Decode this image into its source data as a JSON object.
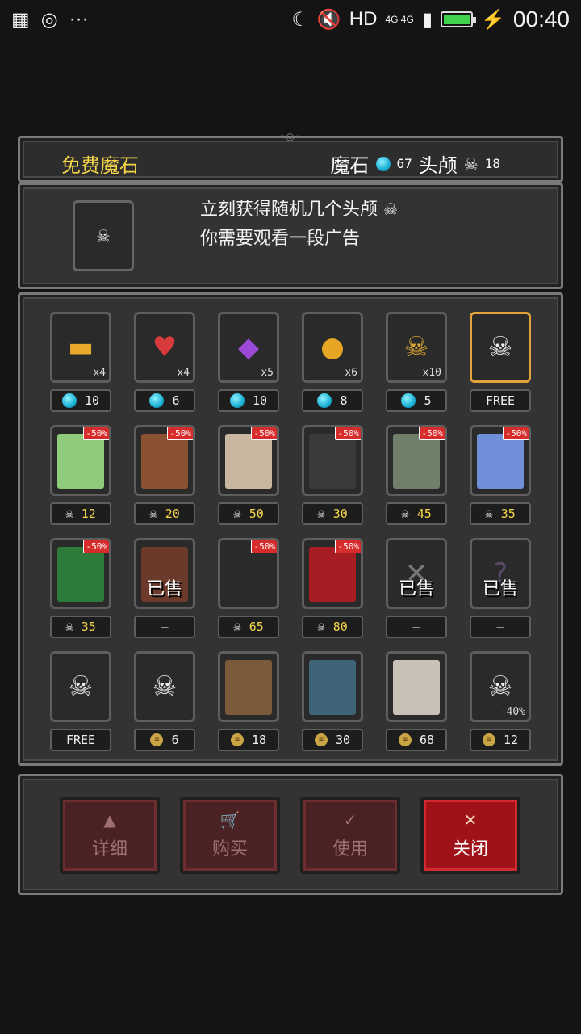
{
  "statusbar": {
    "hd": "HD",
    "network": "4G 4G",
    "time": "00:40"
  },
  "header": {
    "title": "免费魔石",
    "gem_label": "魔石",
    "gem_count": "67",
    "skull_label": "头颅",
    "skull_count": "18"
  },
  "info": {
    "line1": "立刻获得随机几个头颅",
    "line2": "你需要观看一段广告"
  },
  "items": [
    {
      "icon": "gold-bars-icon",
      "glyph": "▬",
      "color": "#e9a92a",
      "qty": "x4",
      "price": "10",
      "currency": "gem"
    },
    {
      "icon": "heart-scroll-icon",
      "glyph": "♥",
      "color": "#d73a3a",
      "qty": "x4",
      "price": "6",
      "currency": "gem"
    },
    {
      "icon": "purple-crystal-icon",
      "glyph": "◆",
      "color": "#9a4ad6",
      "qty": "x5",
      "price": "10",
      "currency": "gem"
    },
    {
      "icon": "golden-apple-icon",
      "glyph": "●",
      "color": "#e6a523",
      "qty": "x6",
      "price": "8",
      "currency": "gem"
    },
    {
      "icon": "skull-amulet-icon",
      "glyph": "☠",
      "color": "#d8a533",
      "qty": "x10",
      "price": "5",
      "currency": "gem"
    },
    {
      "icon": "skull-icon",
      "glyph": "☠",
      "color": "#eeeeee",
      "qty": "",
      "price": "FREE",
      "currency": "none",
      "selected": true
    },
    {
      "icon": "slime-icon",
      "glyph": "",
      "art": "#8ecb7a",
      "discount": "-50%",
      "price": "12",
      "currency": "skull"
    },
    {
      "icon": "treant-icon",
      "glyph": "",
      "art": "#8a5230",
      "discount": "-50%",
      "price": "20",
      "currency": "skull"
    },
    {
      "icon": "skeleton-warrior-icon",
      "glyph": "",
      "art": "#c9b7a0",
      "discount": "-50%",
      "price": "50",
      "currency": "skull"
    },
    {
      "icon": "dark-reaper-icon",
      "glyph": "",
      "art": "#3a3a3a",
      "discount": "-50%",
      "price": "30",
      "currency": "skull"
    },
    {
      "icon": "zombie-knight-icon",
      "glyph": "",
      "art": "#6f7f6a",
      "discount": "-50%",
      "price": "45",
      "currency": "skull"
    },
    {
      "icon": "priestess-icon",
      "glyph": "",
      "art": "#6f90d8",
      "discount": "-50%",
      "price": "35",
      "currency": "skull"
    },
    {
      "icon": "forest-guardian-icon",
      "glyph": "",
      "art": "#2e7a3a",
      "discount": "-50%",
      "price": "35",
      "currency": "skull"
    },
    {
      "icon": "girl-character-icon",
      "glyph": "",
      "art": "#6b3a2a",
      "sold": "已售",
      "price": "—",
      "currency": "none"
    },
    {
      "icon": "shadow-demon-icon",
      "glyph": "",
      "art": "#2b2b2b",
      "discount": "-50%",
      "price": "65",
      "currency": "skull"
    },
    {
      "icon": "witch-icon",
      "glyph": "",
      "art": "#a81c24",
      "discount": "-50%",
      "price": "80",
      "currency": "skull"
    },
    {
      "icon": "crossed-swords-icon",
      "glyph": "✕",
      "color": "#777777",
      "sold": "已售",
      "price": "—",
      "currency": "none"
    },
    {
      "icon": "mystery-door-icon",
      "glyph": "?",
      "color": "#5a4a6a",
      "sold": "已售",
      "price": "—",
      "currency": "none"
    },
    {
      "icon": "skull-to-gem-icon",
      "glyph": "☠",
      "color": "#eeeeee",
      "price": "FREE",
      "currency": "none"
    },
    {
      "icon": "skull-pile-icon",
      "glyph": "☠",
      "color": "#eeeeee",
      "price": "6",
      "currency": "coin"
    },
    {
      "icon": "brown-chest-icon",
      "glyph": "",
      "art": "#7a5a3a",
      "price": "18",
      "currency": "coin"
    },
    {
      "icon": "blue-chest-icon",
      "glyph": "",
      "art": "#3f6377",
      "price": "30",
      "currency": "coin"
    },
    {
      "icon": "golden-chest-icon",
      "glyph": "",
      "art": "#c9c0b6",
      "price": "68",
      "currency": "coin"
    },
    {
      "icon": "skull-scroll-icon",
      "glyph": "☠",
      "color": "#eeeeee",
      "qty": "-40%",
      "price": "12",
      "currency": "coin"
    }
  ],
  "buttons": [
    {
      "label": "详细",
      "icon": "flask-icon",
      "glyph": "▲",
      "active": false
    },
    {
      "label": "购买",
      "icon": "cart-icon",
      "glyph": "🛒",
      "active": false
    },
    {
      "label": "使用",
      "icon": "check-icon",
      "glyph": "✓",
      "active": false
    },
    {
      "label": "关闭",
      "icon": "close-icon",
      "glyph": "✕",
      "active": true
    }
  ]
}
